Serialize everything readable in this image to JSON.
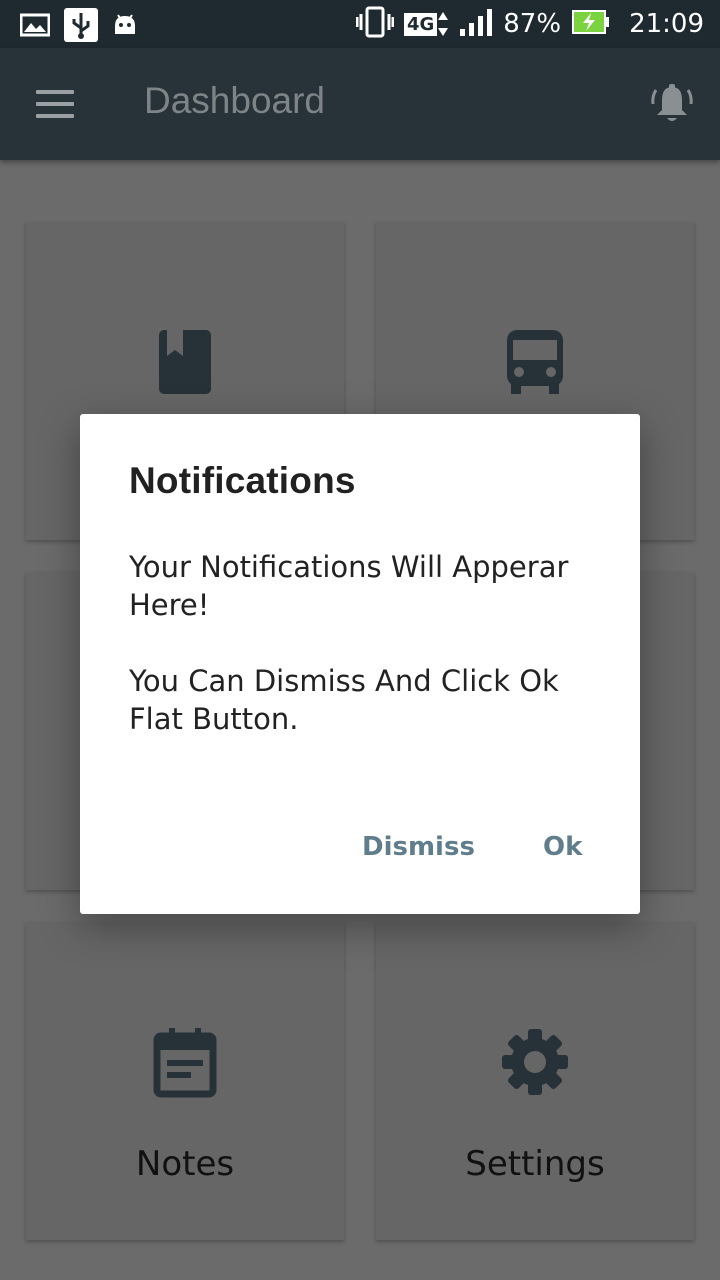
{
  "status_bar": {
    "battery": "87%",
    "network": "4G",
    "time": "21:09",
    "icons": [
      "gallery-icon",
      "usb-icon",
      "android-icon",
      "vibrate-icon",
      "network-4g-icon",
      "signal-icon",
      "battery-charging-icon"
    ]
  },
  "app_bar": {
    "title": "Dashboard",
    "menu_icon": "menu-icon",
    "action_icon": "notifications-bell-icon",
    "background": "#283339"
  },
  "cards": [
    {
      "label": "",
      "icon": "book-icon"
    },
    {
      "label": "",
      "icon": "bus-icon"
    },
    {
      "label": "",
      "icon": ""
    },
    {
      "label": "",
      "icon": ""
    },
    {
      "label": "Notes",
      "icon": "event-note-icon"
    },
    {
      "label": "Settings",
      "icon": "gear-icon"
    }
  ],
  "dialog": {
    "title": "Notifications",
    "body_line1": "Your Notifications Will Apperar Here!",
    "body_line2": "You Can Dismiss And Click Ok Flat Button.",
    "dismiss_label": "Dismiss",
    "ok_label": "Ok",
    "button_color": "#607d8b"
  },
  "colors": {
    "icon_dark": "#263238",
    "scrim_background": "#6b6b6b"
  }
}
